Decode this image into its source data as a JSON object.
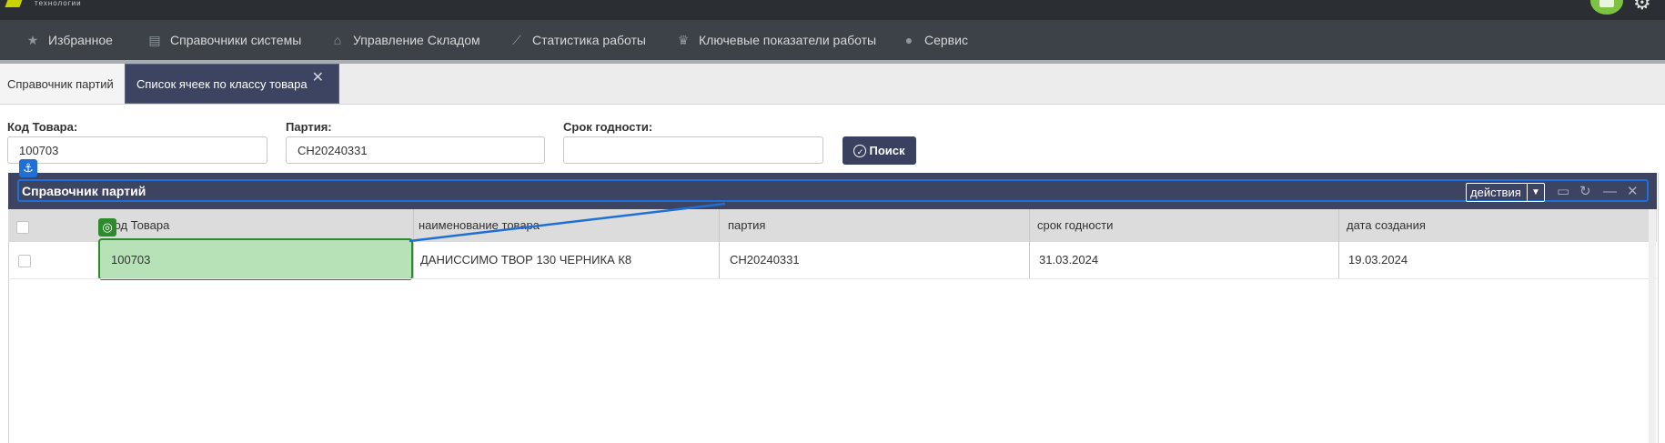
{
  "topbar": {
    "logo_text": "технологии"
  },
  "nav": [
    {
      "label": "Избранное",
      "icon": "star-icon",
      "glyph": "★"
    },
    {
      "label": "Справочники системы",
      "icon": "archive-icon",
      "glyph": "▤"
    },
    {
      "label": "Управление Складом",
      "icon": "warehouse-icon",
      "glyph": "⌂"
    },
    {
      "label": "Статистика работы",
      "icon": "chart-icon",
      "glyph": "⟋"
    },
    {
      "label": "Ключевые показатели работы",
      "icon": "trophy-icon",
      "glyph": "♛"
    },
    {
      "label": "Сервис",
      "icon": "info-icon",
      "glyph": "●"
    }
  ],
  "tabs": [
    {
      "label": "Справочник партий",
      "active": false
    },
    {
      "label": "Список ячеек по классу товара",
      "active": true,
      "close": "✕"
    }
  ],
  "form": {
    "code_label": "Код Товара:",
    "code_value": "100703",
    "batch_label": "Партия:",
    "batch_value": "CH20240331",
    "expiry_label": "Срок годности:",
    "expiry_value": "",
    "search_label": "Поиск"
  },
  "panel": {
    "title": "Справочник партий",
    "actions_label": "действия"
  },
  "grid": {
    "columns": [
      "Код Товара",
      "наименование товара",
      "партия",
      "срок годности",
      "дата создания"
    ],
    "rows": [
      {
        "code": "100703",
        "name": "ДАНИССИМО ТВОР 130 ЧЕРНИКА К8",
        "batch": "CH20240331",
        "expiry": "31.03.2024",
        "created": "19.03.2024"
      }
    ]
  },
  "colors": {
    "navbar": "#3c4248",
    "panel_header": "#3c4462",
    "highlight": "#b7e1b7",
    "anchor": "#1f6fd6",
    "target": "#2d8b2d"
  }
}
